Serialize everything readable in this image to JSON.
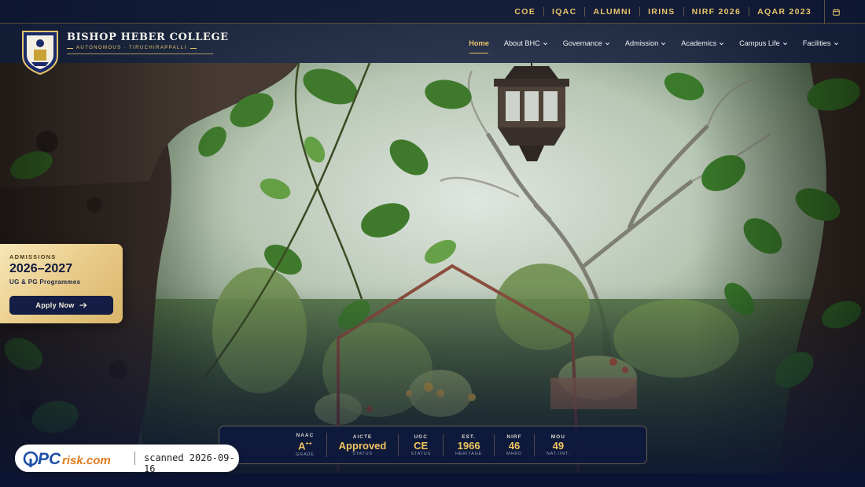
{
  "topbar": {
    "links": [
      "COE",
      "IQAC",
      "ALUMNI",
      "IRINS",
      "NIRF 2026",
      "AQAR 2023"
    ],
    "calendar_icon": "calendar-icon"
  },
  "brand": {
    "name": "Bishop Heber College",
    "subtitle": "AUTONOMOUS · TIRUCHIRAPPALLI",
    "crest_icon": "college-crest"
  },
  "nav": {
    "items": [
      {
        "label": "Home",
        "active": true
      },
      {
        "label": "About BHC"
      },
      {
        "label": "Governance"
      },
      {
        "label": "Admission"
      },
      {
        "label": "Academics"
      },
      {
        "label": "Campus Life"
      },
      {
        "label": "Facilities"
      }
    ]
  },
  "admissions": {
    "label": "ADMISSIONS",
    "year": "2026–2027",
    "programmes": "UG & PG Programmes",
    "apply_label": "Apply Now"
  },
  "stats": [
    {
      "label": "NAAC",
      "value": "A",
      "sup": "++",
      "sub": "GRADE"
    },
    {
      "label": "AICTE",
      "value": "Approved",
      "sub": "STATUS"
    },
    {
      "label": "UGC",
      "value": "CE",
      "sub": "STATUS"
    },
    {
      "label": "EST.",
      "value": "1966",
      "sub": "HERITAGE"
    },
    {
      "label": "NIRF",
      "value": "46",
      "sub": "MHRD"
    },
    {
      "label": "MOU",
      "value": "49",
      "sub": "NAT./INT."
    }
  ],
  "watermark": {
    "brand": "PCrisk.com",
    "text": "scanned 2026-09-16"
  },
  "colors": {
    "navy": "#0c1433",
    "gold": "#e8c56a",
    "stat_gold": "#f2c660"
  }
}
